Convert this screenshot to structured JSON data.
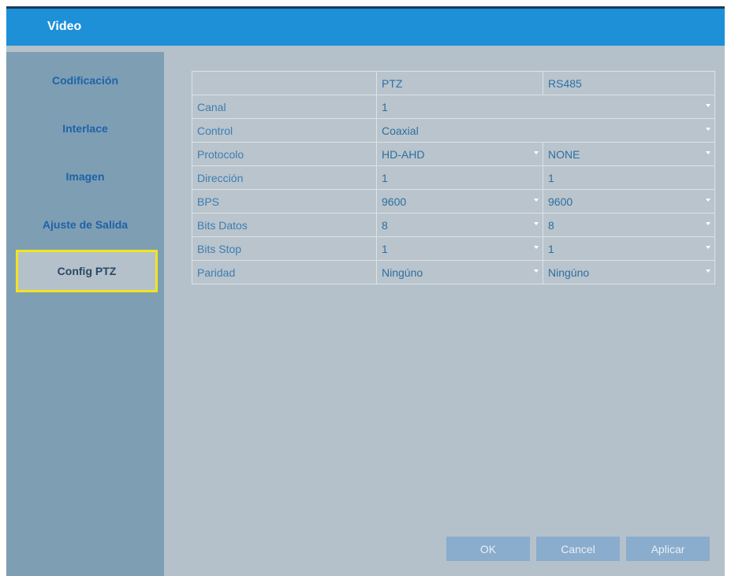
{
  "window": {
    "title": "Video"
  },
  "sidebar": {
    "items": [
      {
        "label": "Codificación"
      },
      {
        "label": "Interlace"
      },
      {
        "label": "Imagen"
      },
      {
        "label": "Ajuste de Salida"
      },
      {
        "label": "Config PTZ",
        "active": true
      }
    ],
    "highlight_color": "#f2e420"
  },
  "table": {
    "headers": [
      "",
      "PTZ",
      "RS485"
    ],
    "rows": [
      {
        "label": "Canal",
        "merged": true,
        "value": "1",
        "dropdown": true
      },
      {
        "label": "Control",
        "merged": true,
        "value": "Coaxial",
        "dropdown": true
      },
      {
        "label": "Protocolo",
        "ptz": "HD-AHD",
        "rs485": "NONE",
        "ptz_dropdown": true,
        "rs485_dropdown": true
      },
      {
        "label": "Dirección",
        "ptz": "1",
        "rs485": "1",
        "ptz_dropdown": false,
        "rs485_dropdown": false
      },
      {
        "label": "BPS",
        "ptz": "9600",
        "rs485": "9600",
        "ptz_dropdown": true,
        "rs485_dropdown": true
      },
      {
        "label": "Bits Datos",
        "ptz": "8",
        "rs485": "8",
        "ptz_dropdown": true,
        "rs485_dropdown": true
      },
      {
        "label": "Bits Stop",
        "ptz": "1",
        "rs485": "1",
        "ptz_dropdown": true,
        "rs485_dropdown": true
      },
      {
        "label": "Paridad",
        "ptz": "Ningúno",
        "rs485": "Ningúno",
        "ptz_dropdown": true,
        "rs485_dropdown": true
      }
    ]
  },
  "buttons": {
    "ok": "OK",
    "cancel": "Cancel",
    "apply": "Aplicar"
  },
  "colors": {
    "title_bar": "#1e90d8",
    "sidebar": "#7e9eb3",
    "content": "#b5c1ca",
    "button": "#8aaccd"
  }
}
